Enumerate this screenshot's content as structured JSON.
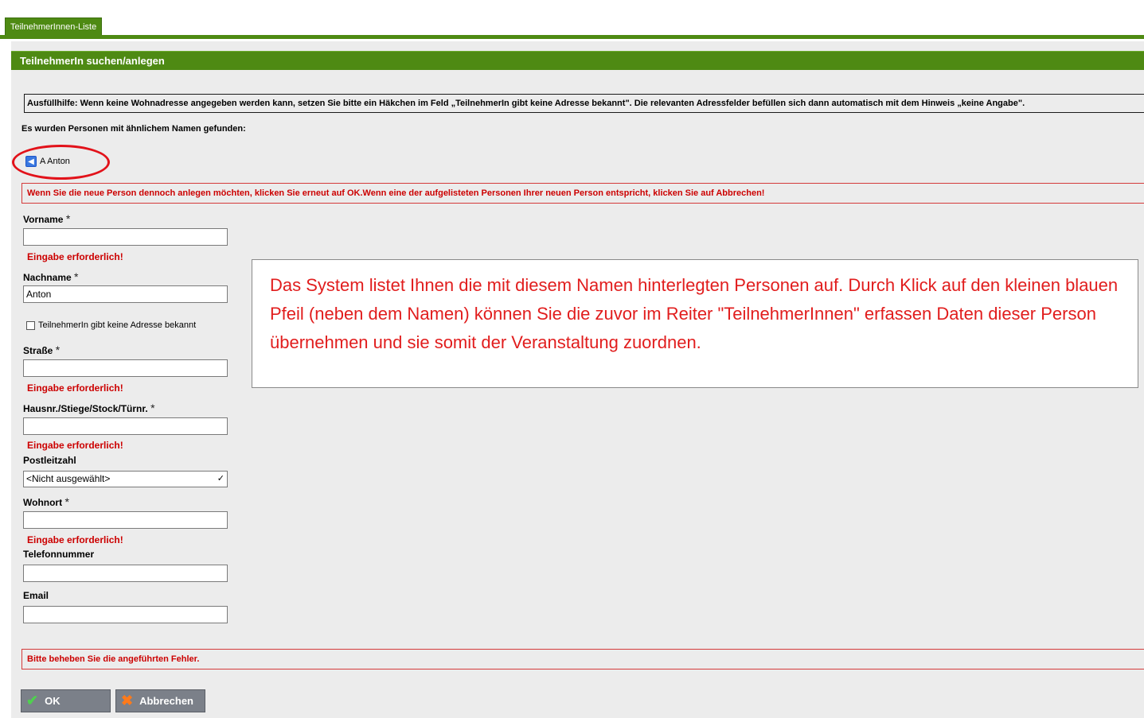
{
  "tab": {
    "label": "TeilnehmerInnen-Liste"
  },
  "panel": {
    "title": "TeilnehmerIn suchen/anlegen"
  },
  "hint": "Ausfüllhilfe: Wenn keine Wohnadresse angegeben werden kann, setzen Sie bitte ein Häkchen im Feld „TeilnehmerIn gibt keine Adresse bekannt\". Die relevanten Adressfelder befüllen sich dann automatisch mit dem Hinweis „keine Angabe\".",
  "similar": {
    "title": "Es wurden Personen mit ähnlichem Namen gefunden:",
    "items": [
      {
        "label": "A Anton"
      }
    ]
  },
  "warning": "Wenn Sie die neue Person dennoch anlegen möchten, klicken Sie erneut auf OK.Wenn eine der aufgelisteten Personen Ihrer neuen Person entspricht, klicken Sie auf Abbrechen!",
  "form": {
    "required_mark": "*",
    "error_text": "Eingabe erforderlich!",
    "vorname": {
      "label": "Vorname",
      "value": ""
    },
    "nachname": {
      "label": "Nachname",
      "value": "Anton"
    },
    "no_address": {
      "label": "TeilnehmerIn gibt keine Adresse bekannt",
      "checked": false
    },
    "strasse": {
      "label": "Straße",
      "value": ""
    },
    "hausnr": {
      "label": "Hausnr./Stiege/Stock/Türnr.",
      "value": ""
    },
    "plz": {
      "label": "Postleitzahl",
      "selected": "<Nicht ausgewählt>"
    },
    "wohnort": {
      "label": "Wohnort",
      "value": ""
    },
    "telefon": {
      "label": "Telefonnummer",
      "value": ""
    },
    "email": {
      "label": "Email",
      "value": ""
    }
  },
  "callout": "Das System listet Ihnen die mit diesem Namen hinterlegten Personen auf. Durch Klick auf den kleinen blauen Pfeil (neben dem Namen) können Sie die zuvor im Reiter \"TeilnehmerInnen\" erfassen Daten dieser Person übernehmen und sie somit der Veranstaltung zuordnen.",
  "bottom_error": "Bitte beheben Sie die angeführten Fehler.",
  "buttons": {
    "ok": "OK",
    "cancel": "Abbrechen"
  },
  "colors": {
    "header_green": "#4e8a13",
    "error_red": "#cc0000",
    "callout_red": "#e11d1d"
  }
}
